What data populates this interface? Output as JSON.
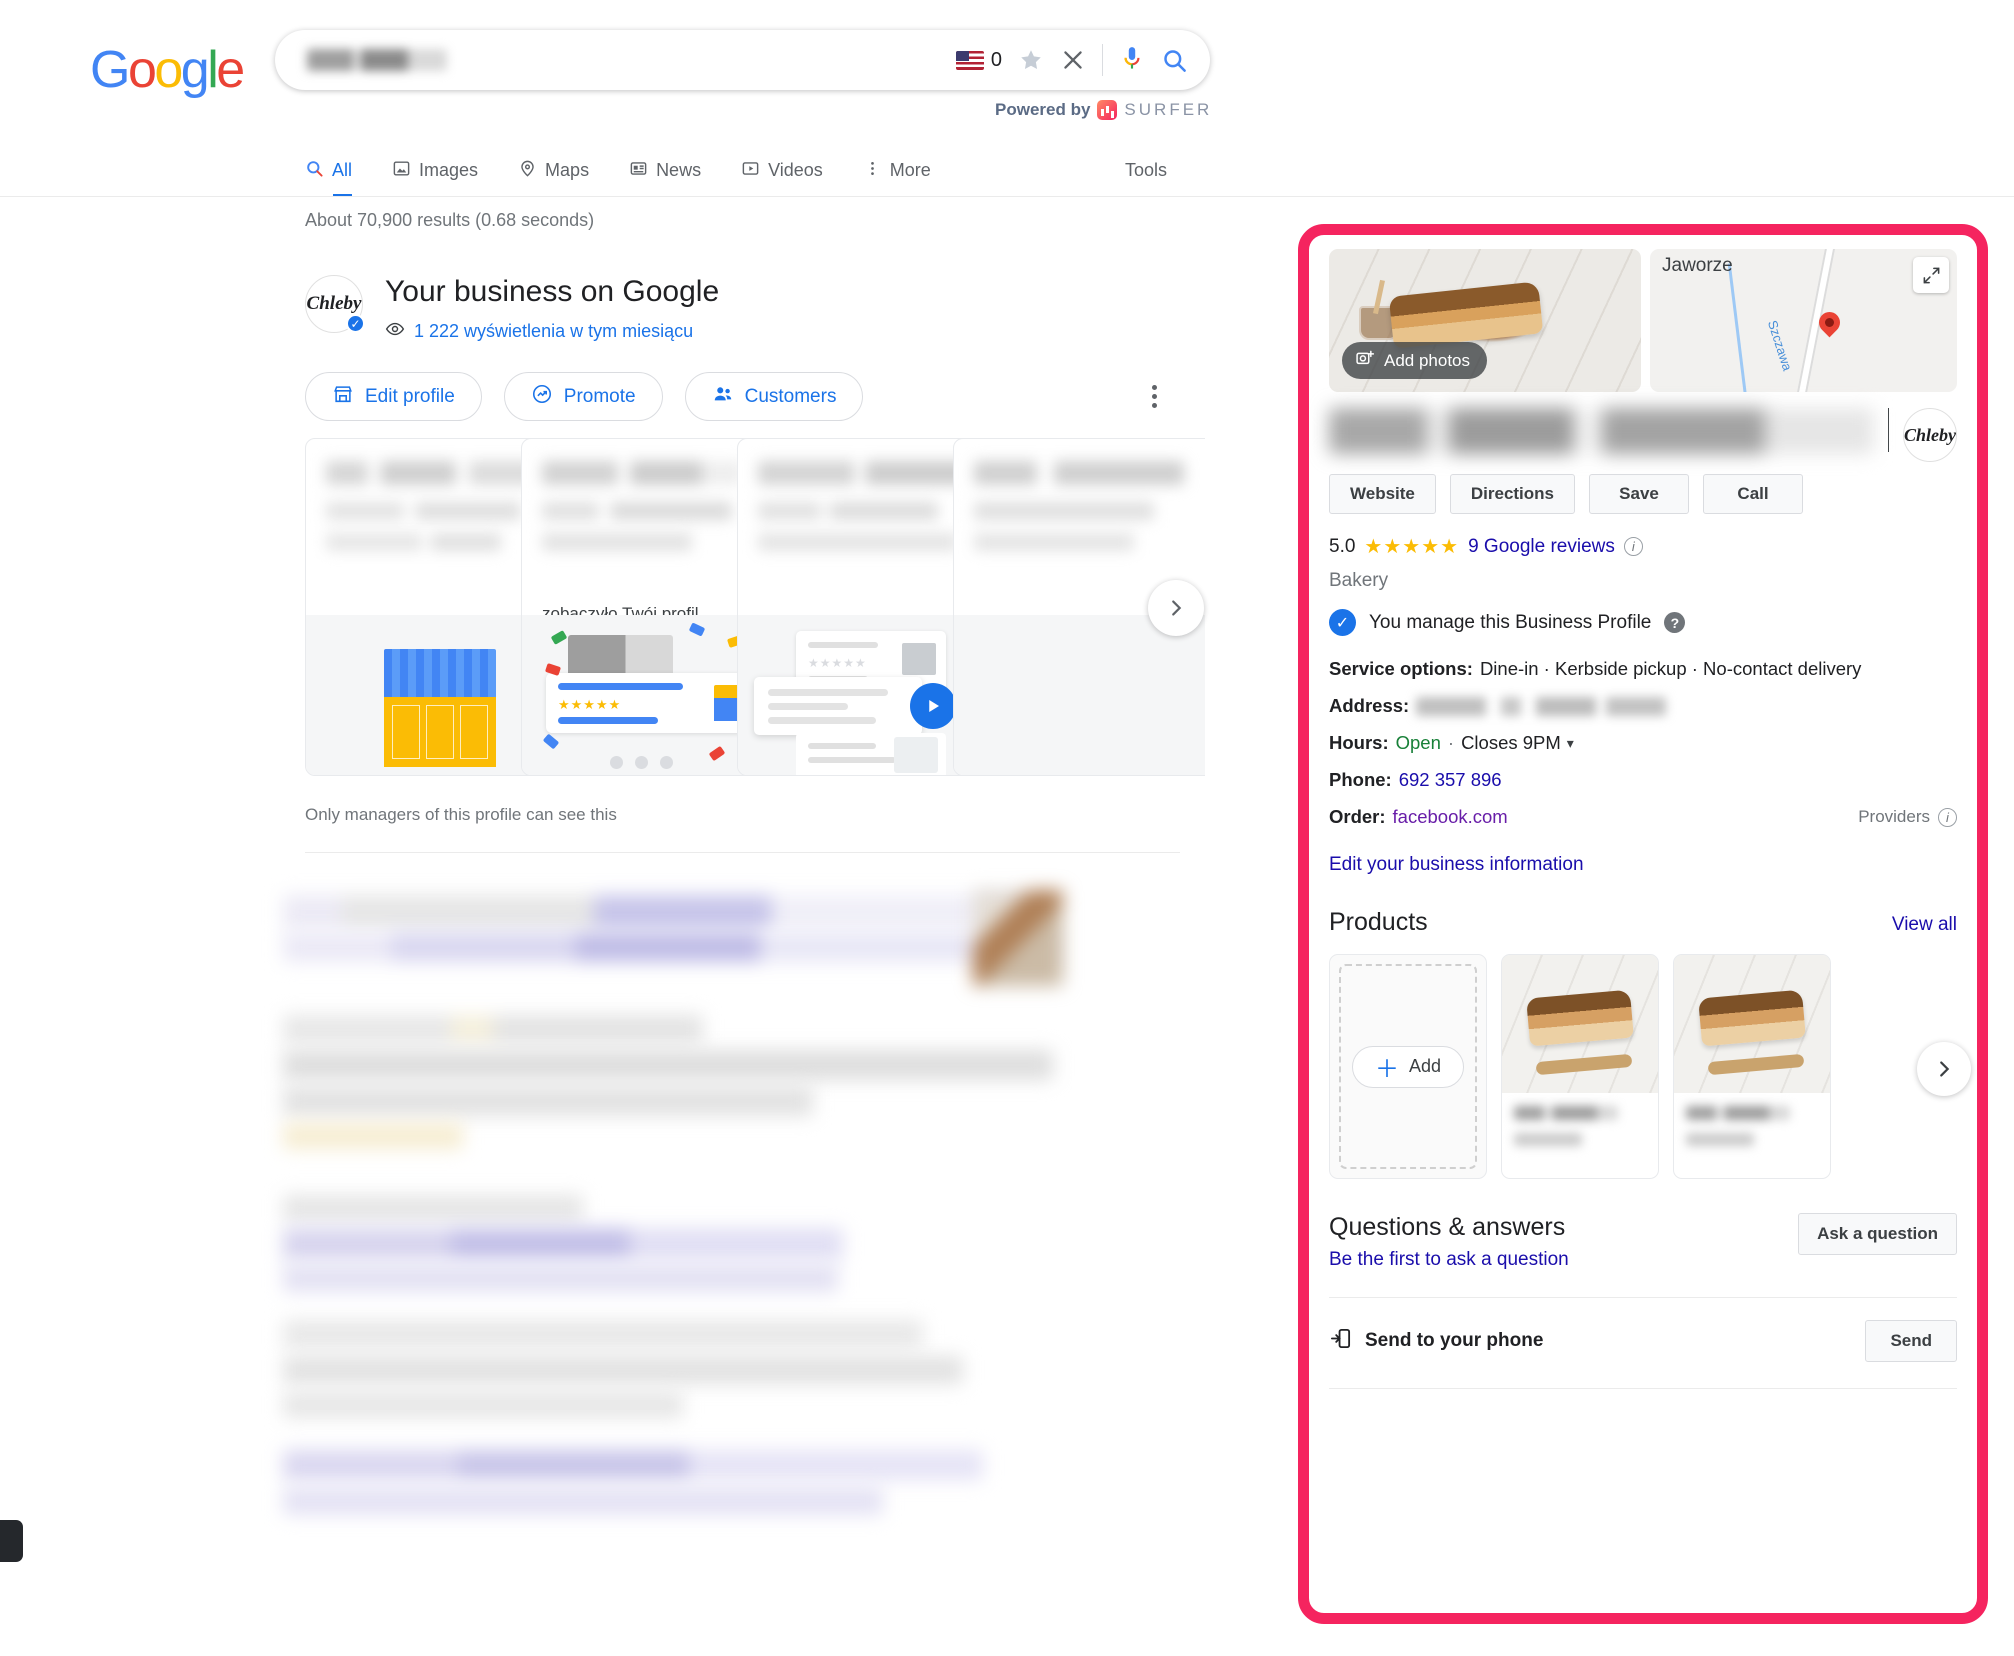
{
  "header": {
    "logo_text": "Google",
    "search": {
      "query_blurred": true,
      "placeholder": "Search"
    },
    "flag_count": "0",
    "icons": [
      "us-flag-icon",
      "star-icon",
      "close-icon",
      "microphone-icon",
      "search-icon"
    ],
    "powered_by": "Powered by",
    "surfer_word": "SURFER"
  },
  "nav": {
    "tabs": [
      {
        "label": "All",
        "icon": "search-icon",
        "active": true
      },
      {
        "label": "Images",
        "icon": "image-icon",
        "active": false
      },
      {
        "label": "Maps",
        "icon": "location-pin-icon",
        "active": false
      },
      {
        "label": "News",
        "icon": "newspaper-icon",
        "active": false
      },
      {
        "label": "Videos",
        "icon": "video-icon",
        "active": false
      },
      {
        "label": "More",
        "icon": "kebab-icon",
        "active": false
      }
    ],
    "tools_label": "Tools"
  },
  "main": {
    "result_stats": "About 70,900 results (0.68 seconds)",
    "business_title": "Your business on Google",
    "views_text": "1 222 wyświetlenia w tym miesiącu",
    "avatar_mark": "Chleby",
    "actions": [
      {
        "label": "Edit profile",
        "icon": "storefront-icon"
      },
      {
        "label": "Promote",
        "icon": "trending-up-icon"
      },
      {
        "label": "Customers",
        "icon": "people-icon"
      }
    ],
    "carousel": {
      "cards": [
        {
          "caption": "",
          "art": "storefront"
        },
        {
          "caption": "zobaczyło Twój profil…",
          "art": "review-confetti"
        },
        {
          "caption": "",
          "art": "video-card"
        },
        {
          "caption": "",
          "art": "blank"
        }
      ],
      "next_icon": "chevron-right-icon"
    },
    "managers_note": "Only managers of this profile can see this"
  },
  "knowledge_panel": {
    "highlight_color": "#F5245F",
    "photo": {
      "add_photos_label": "Add photos",
      "icon": "add-photo-icon"
    },
    "map": {
      "place_label": "Jaworze",
      "river_label": "Szczawa",
      "expand_icon": "expand-icon",
      "pin_icon": "map-pin-icon"
    },
    "logo_mark": "Chleby",
    "buttons": [
      "Website",
      "Directions",
      "Save",
      "Call"
    ],
    "rating": {
      "score": "5.0",
      "stars": "★★★★★",
      "reviews_link": "9 Google reviews",
      "info_icon": "info-icon"
    },
    "category": "Bakery",
    "manage": {
      "text": "You manage this Business Profile",
      "badge_icon": "verified-badge-icon",
      "help_icon": "help-icon"
    },
    "details": {
      "service_options_label": "Service options:",
      "service_options_value": "Dine-in · Kerbside pickup · No-contact delivery",
      "address_label": "Address:",
      "address_value_blurred": true,
      "hours_label": "Hours:",
      "hours_state": "Open",
      "hours_sep": "·",
      "hours_close": "Closes 9PM",
      "hours_caret": "▾",
      "phone_label": "Phone:",
      "phone_value": "692 357 896",
      "order_label": "Order:",
      "order_value": "facebook.com",
      "providers_label": "Providers",
      "providers_info_icon": "info-icon"
    },
    "edit_business_info": "Edit your business information",
    "products": {
      "title": "Products",
      "view_all": "View all",
      "add_label": "Add",
      "add_icon": "plus-icon",
      "next_icon": "chevron-right-icon",
      "items": [
        {
          "name_blurred": true,
          "price_blurred": true
        },
        {
          "name_blurred": true,
          "price_blurred": true
        }
      ]
    },
    "qa": {
      "title": "Questions & answers",
      "subtitle": "Be the first to ask a question",
      "button": "Ask a question"
    },
    "send_to_phone": {
      "label": "Send to your phone",
      "icon": "send-to-phone-icon",
      "button": "Send"
    }
  }
}
